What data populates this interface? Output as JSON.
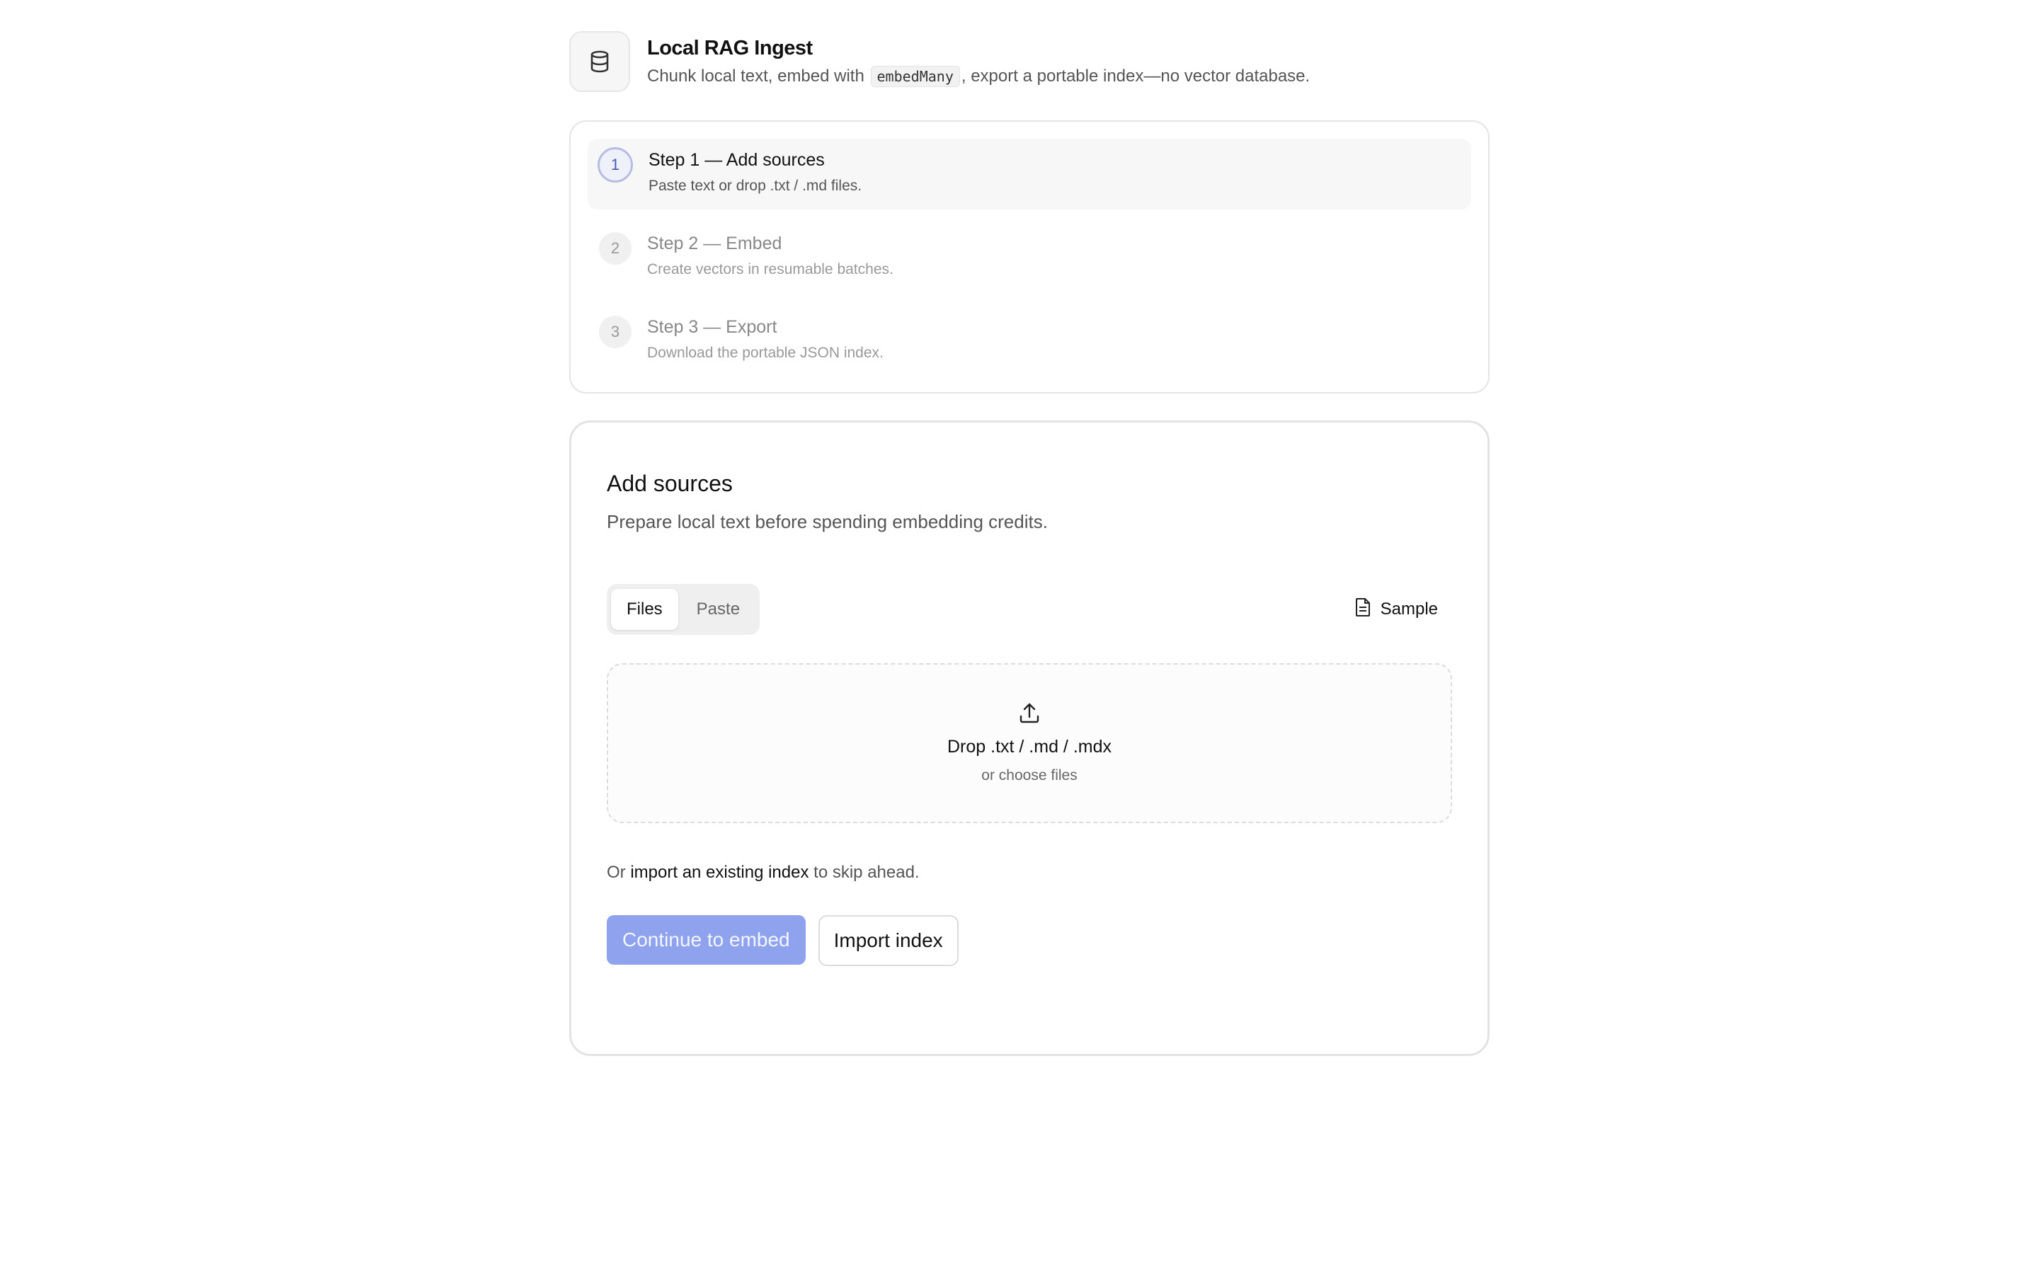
{
  "header": {
    "icon": "database-icon",
    "title": "Local RAG Ingest",
    "subtitle_before": "Chunk local text, embed with",
    "subtitle_code": "embedMany",
    "subtitle_after": ", export a portable index—no vector database."
  },
  "steps": [
    {
      "number": "1",
      "title": "Step 1 — Add sources",
      "description": "Paste text or drop .txt / .md files.",
      "active": true
    },
    {
      "number": "2",
      "title": "Step 2 — Embed",
      "description": "Create vectors in resumable batches.",
      "active": false
    },
    {
      "number": "3",
      "title": "Step 3 — Export",
      "description": "Download the portable JSON index.",
      "active": false
    }
  ],
  "main": {
    "title": "Add sources",
    "subtitle": "Prepare local text before spending embedding credits.",
    "tabs": [
      {
        "label": "Files",
        "active": true
      },
      {
        "label": "Paste",
        "active": false
      }
    ],
    "sample_label": "Sample",
    "sample_icon": "file-text-icon",
    "dropzone": {
      "icon": "upload-icon",
      "title": "Drop .txt / .md / .mdx",
      "subtitle": "or choose files"
    },
    "import_line": {
      "before": "Or",
      "link": "import an existing index",
      "after": "to skip ahead."
    },
    "continue_label": "Continue to embed",
    "import_label": "Import index"
  },
  "colors": {
    "accent": "#8fa2ee",
    "active_step_ring": "#b7bde0",
    "active_step_text": "#4a58b8"
  }
}
